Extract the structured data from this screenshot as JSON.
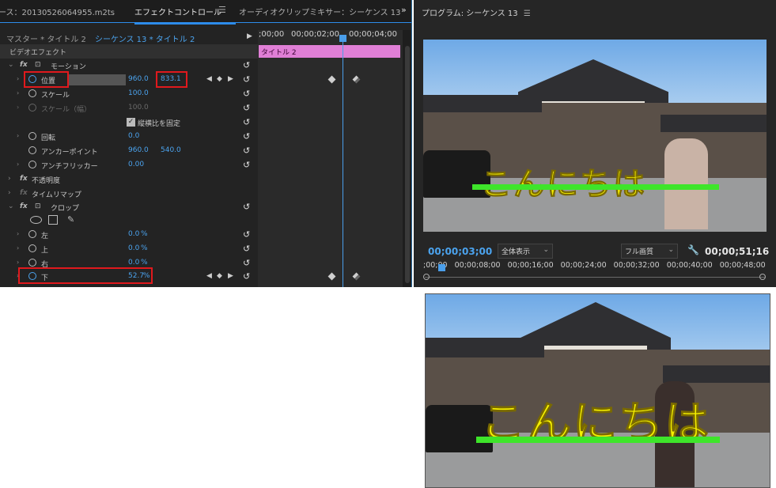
{
  "effect_panel": {
    "tabs": {
      "source": "ース：20130526064955.m2ts",
      "effect_controls": "エフェクトコントロール",
      "audio_mixer": "オーディオクリップミキサー：シーケンス 13"
    },
    "master_label": "マスター * タイトル 2",
    "sequence_label": "シーケンス 13 * タイトル 2",
    "section_title": "ビデオエフェクト",
    "rows": {
      "motion": "モーション",
      "position": "位置",
      "position_x": "960.0",
      "position_y": "833.1",
      "scale": "スケール",
      "scale_val": "100.0",
      "scale_w": "スケール（幅）",
      "scale_w_val": "100.0",
      "uniform": "縦横比を固定",
      "rotation": "回転",
      "rotation_val": "0.0",
      "anchor": "アンカーポイント",
      "anchor_x": "960.0",
      "anchor_y": "540.0",
      "antiflicker": "アンチフリッカー",
      "antiflicker_val": "0.00",
      "opacity": "不透明度",
      "time_remap": "タイムリマップ",
      "crop": "クロップ",
      "left": "左",
      "left_val": "0.0",
      "top": "上",
      "top_val": "0.0",
      "right": "右",
      "right_val": "0.0",
      "bottom": "下",
      "bottom_val": "52.7",
      "percent": "%"
    },
    "timeline": {
      "tc0": ";00;00",
      "tc1": "00;00;02;00",
      "tc2": "00;00;04;00",
      "clip_label": "タイトル 2"
    }
  },
  "program_monitor": {
    "title": "プログラム: シーケンス 13",
    "caption": "こんにちは",
    "current_tc": "00;00;03;00",
    "fit_label": "全体表示",
    "quality_label": "フル画質",
    "duration_tc": "00;00;51;16",
    "ruler": ";00;00   00;00;08;00   00;00;16;00   00;00;24;00   00;00;32;00   00;00;40;00   00;00;48;00"
  },
  "preview_bottom": {
    "caption": "こんにちは"
  },
  "colors": {
    "accent_blue": "#2d8ceb",
    "caption_yellow": "#f5f000",
    "underline_green": "#3ee52a",
    "highlight_red": "#e0191d",
    "clip_pink": "#e07fd6"
  }
}
